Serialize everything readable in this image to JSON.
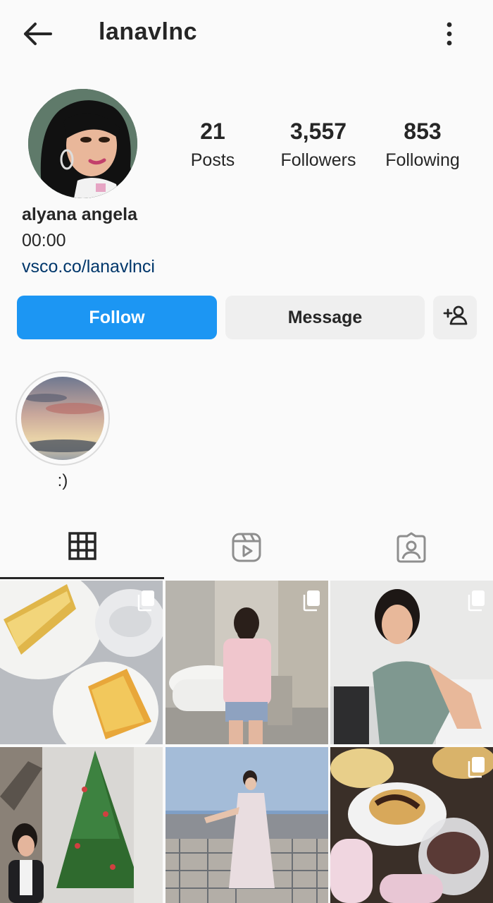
{
  "header": {
    "username": "lanavlnc"
  },
  "profile": {
    "stats": [
      {
        "value": "21",
        "label": "Posts"
      },
      {
        "value": "3,557",
        "label": "Followers"
      },
      {
        "value": "853",
        "label": "Following"
      }
    ],
    "full_name": "alyana angela",
    "bio": "00:00",
    "link": "vsco.co/lanavlnci"
  },
  "actions": {
    "follow": "Follow",
    "message": "Message"
  },
  "highlights": [
    {
      "label": ":)"
    }
  ],
  "tabs": [
    "grid-icon",
    "reels-icon",
    "tagged-icon"
  ],
  "colors": {
    "accent": "#1c96f3",
    "text": "#262626",
    "link": "#00376b"
  }
}
